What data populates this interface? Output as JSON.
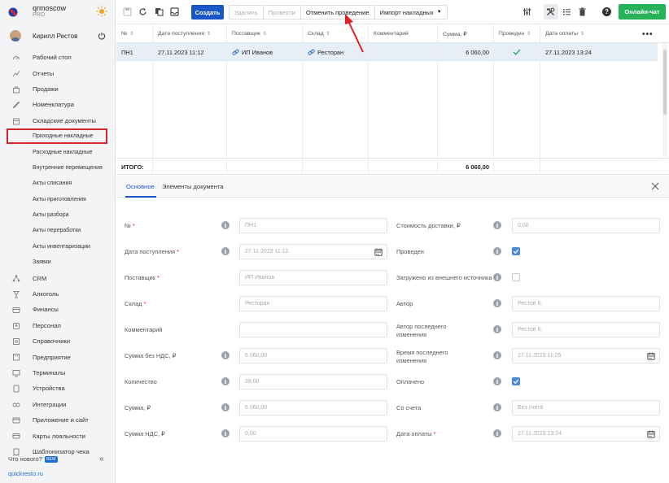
{
  "brand": {
    "name": "qrmoscow",
    "plan": "PRO"
  },
  "user": {
    "name": "Кирилл Рестов"
  },
  "sidebar": {
    "items": [
      {
        "label": "Рабочий стол",
        "icon": "dashboard-icon"
      },
      {
        "label": "Отчеты",
        "icon": "reports-icon"
      },
      {
        "label": "Продажи",
        "icon": "sales-icon"
      },
      {
        "label": "Номенклатура",
        "icon": "nomenclature-icon"
      },
      {
        "label": "Складские документы",
        "icon": "warehouse-icon"
      },
      {
        "label": "Приходные накладные",
        "sub": true,
        "active": true
      },
      {
        "label": "Расходные накладные",
        "sub": true
      },
      {
        "label": "Внутренние перемещения",
        "sub": true
      },
      {
        "label": "Акты списания",
        "sub": true
      },
      {
        "label": "Акты приготовления",
        "sub": true
      },
      {
        "label": "Акты разбора",
        "sub": true
      },
      {
        "label": "Акты переработки",
        "sub": true
      },
      {
        "label": "Акты инвентаризации",
        "sub": true
      },
      {
        "label": "Заявки",
        "sub": true
      },
      {
        "label": "CRM",
        "icon": "crm-icon"
      },
      {
        "label": "Алкоголь",
        "icon": "alcohol-icon"
      },
      {
        "label": "Финансы",
        "icon": "finance-icon"
      },
      {
        "label": "Персонал",
        "icon": "staff-icon"
      },
      {
        "label": "Справочники",
        "icon": "reference-icon"
      },
      {
        "label": "Предприятие",
        "icon": "enterprise-icon"
      },
      {
        "label": "Терминалы",
        "icon": "terminal-icon"
      },
      {
        "label": "Устройства",
        "icon": "devices-icon"
      },
      {
        "label": "Интеграции",
        "icon": "integrations-icon"
      },
      {
        "label": "Приложение и сайт",
        "icon": "app-icon"
      },
      {
        "label": "Карты лояльности",
        "icon": "loyalty-icon"
      },
      {
        "label": "Шаблонизатор чека",
        "icon": "receipt-icon"
      }
    ],
    "whats_new": "Что нового?",
    "new_badge": "NEW",
    "site": "quickresto.ru"
  },
  "toolbar": {
    "create": "Создать",
    "delete": "Удалить",
    "post": "Провести",
    "unpost": "Отменить проведение",
    "import": "Импорт накладных",
    "online_chat": "Онлайн-чат"
  },
  "table": {
    "headers": [
      "№",
      "Дата поступления",
      "Поставщик",
      "Склад",
      "Комментарий",
      "Сумма, ₽",
      "Проведен",
      "Дата оплаты"
    ],
    "rows": [
      {
        "num": "ПН1",
        "date": "27.11.2023 11:12",
        "supplier": "ИП Иванов",
        "warehouse": "Ресторан",
        "comment": "",
        "sum": "6 060,00",
        "posted": true,
        "paid_date": "27.11.2023 13:24"
      }
    ],
    "total_label": "ИТОГО:",
    "total_sum": "6 060,00"
  },
  "detail": {
    "tabs": [
      "Основное",
      "Элементы документа"
    ],
    "left": [
      {
        "label": "№",
        "required": true,
        "value": "ПН1"
      },
      {
        "label": "Дата поступления",
        "required": true,
        "value": "27.11.2023 11:12"
      },
      {
        "label": "Поставщик",
        "required": true,
        "value": "ИП Иванов"
      },
      {
        "label": "Склад",
        "required": true,
        "value": "Ресторан"
      },
      {
        "label": "Комментарий",
        "required": false,
        "value": ""
      },
      {
        "label": "Сумма без НДС, ₽",
        "required": false,
        "value": "6 060,00"
      },
      {
        "label": "Количество",
        "required": false,
        "value": "28,00"
      },
      {
        "label": "Сумма, ₽",
        "required": false,
        "value": "6 060,00"
      },
      {
        "label": "Сумма НДС, ₽",
        "required": false,
        "value": "0,00"
      }
    ],
    "right": [
      {
        "label": "Стоимость доставки, ₽",
        "value": "0,00"
      },
      {
        "label": "Проведен",
        "checked": true
      },
      {
        "label": "Загружено из внешнего источника",
        "checked": false
      },
      {
        "label": "Автор",
        "value": "Рестов К."
      },
      {
        "label": "Автор последнего",
        "label2": "изменения",
        "value": "Рестов К."
      },
      {
        "label": "Время последнего",
        "label2": "изменения",
        "value": "27.11.2023 11:25"
      },
      {
        "label": "Оплачено",
        "checked": true
      },
      {
        "label": "Со счета",
        "value": "Без счета"
      },
      {
        "label": "Дата оплаты",
        "required": true,
        "value": "27.11.2023 13:24"
      }
    ]
  },
  "colors": {
    "accent": "#1a57c6",
    "online": "#27b25a",
    "highlight": "#d0282e"
  }
}
